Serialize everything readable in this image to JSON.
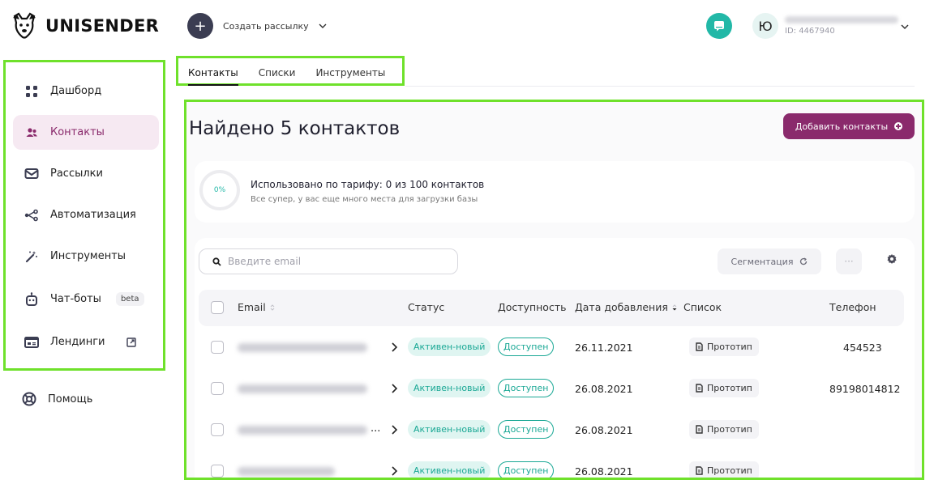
{
  "header": {
    "logo_text": "UNISENDER",
    "create_label": "Создать рассылку",
    "create_plus": "+",
    "avatar_letter": "Ю",
    "user_id": "ID: 4467940"
  },
  "sidebar": {
    "items": [
      {
        "label": "Дашборд",
        "icon": "dashboard-icon"
      },
      {
        "label": "Контакты",
        "icon": "contacts-icon",
        "active": true
      },
      {
        "label": "Рассылки",
        "icon": "mail-icon"
      },
      {
        "label": "Автоматизация",
        "icon": "automation-icon"
      },
      {
        "label": "Инструменты",
        "icon": "magic-wand-icon"
      },
      {
        "label": "Чат-боты",
        "icon": "robot-icon",
        "badge": "beta"
      },
      {
        "label": "Лендинги",
        "icon": "landing-icon",
        "external": true
      }
    ],
    "help_label": "Помощь"
  },
  "tabs": [
    {
      "label": "Контакты",
      "active": true
    },
    {
      "label": "Списки"
    },
    {
      "label": "Инструменты"
    }
  ],
  "main": {
    "title": "Найдено 5 контактов",
    "add_button": "Добавить контакты",
    "usage": {
      "percent_label": "0%",
      "title": "Использовано по тарифу: 0 из 100 контактов",
      "subtitle": "Все супер, у вас еще много места для загрузки базы"
    },
    "search_placeholder": "Введите email",
    "segment_button": "Сегментация",
    "more_button": "···",
    "columns": {
      "email": "Email",
      "status": "Статус",
      "availability": "Доступность",
      "date": "Дата добавления",
      "list": "Список",
      "phone": "Телефон"
    },
    "rows": [
      {
        "status": "Активен-новый",
        "availability": "Доступен",
        "date": "26.11.2021",
        "list": "Прототип",
        "phone": "454523",
        "ellipsis": ""
      },
      {
        "status": "Активен-новый",
        "availability": "Доступен",
        "date": "26.08.2021",
        "list": "Прототип",
        "phone": "89198014812",
        "ellipsis": ""
      },
      {
        "status": "Активен-новый",
        "availability": "Доступен",
        "date": "26.08.2021",
        "list": "Прототип",
        "phone": "",
        "ellipsis": "..."
      },
      {
        "status": "Активен-новый",
        "availability": "Доступен",
        "date": "26.08.2021",
        "list": "Прототип",
        "phone": "",
        "ellipsis": ""
      }
    ]
  },
  "colors": {
    "accent": "#8a2a6c",
    "teal": "#1aa895",
    "highlight_border": "#6fe12b"
  }
}
